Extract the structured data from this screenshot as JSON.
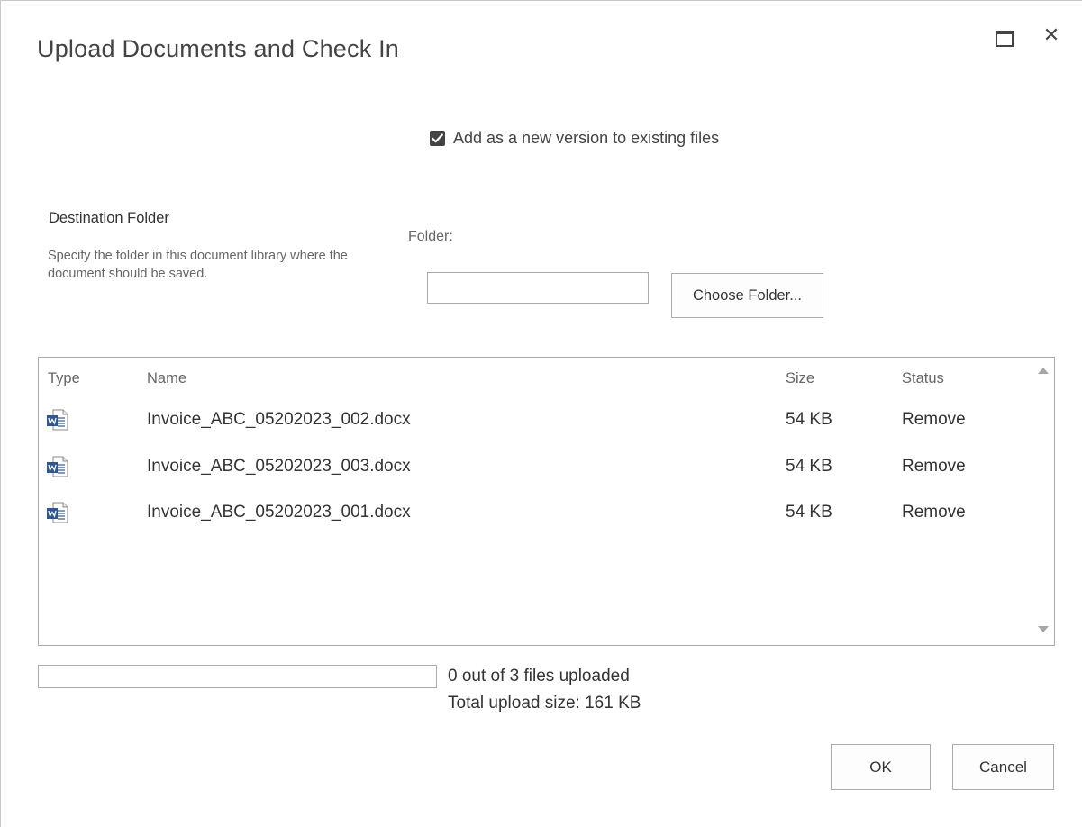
{
  "dialog": {
    "title": "Upload Documents and Check In",
    "maximize_icon": "maximize-icon",
    "close_icon": "close-icon",
    "close_glyph": "✕"
  },
  "version_option": {
    "checked": true,
    "label": "Add as a new version to existing files"
  },
  "destination": {
    "heading": "Destination Folder",
    "description": "Specify the folder in this document library where the document should be saved.",
    "folder_label": "Folder:",
    "folder_value": "",
    "choose_button": "Choose Folder..."
  },
  "file_table": {
    "columns": {
      "type": "Type",
      "name": "Name",
      "size": "Size",
      "status": "Status"
    },
    "rows": [
      {
        "icon": "word-document-icon",
        "name": "Invoice_ABC_05202023_002.docx",
        "size": "54 KB",
        "status": "Remove"
      },
      {
        "icon": "word-document-icon",
        "name": "Invoice_ABC_05202023_003.docx",
        "size": "54 KB",
        "status": "Remove"
      },
      {
        "icon": "word-document-icon",
        "name": "Invoice_ABC_05202023_001.docx",
        "size": "54 KB",
        "status": "Remove"
      }
    ]
  },
  "progress": {
    "fraction": 0,
    "text": "0 out of 3 files uploaded",
    "total_size": "Total upload size: 161 KB"
  },
  "buttons": {
    "ok": "OK",
    "cancel": "Cancel"
  },
  "colors": {
    "word_blue": "#2b579a",
    "accent": "#0072c6"
  }
}
